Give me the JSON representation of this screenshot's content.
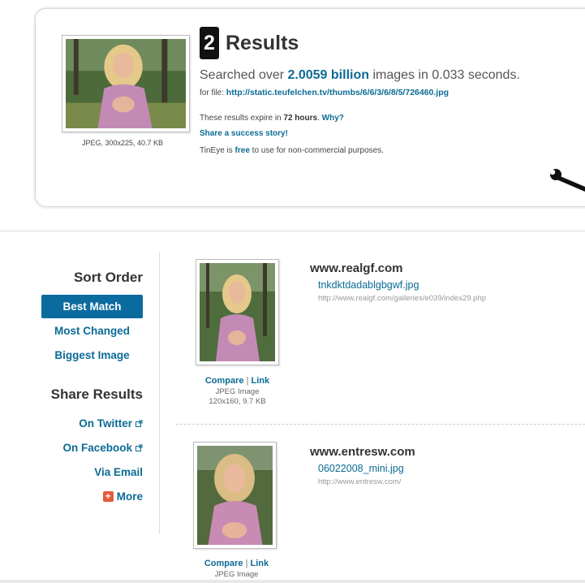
{
  "summary": {
    "result_count": "2",
    "results_word": "Results",
    "searched_prefix": "Searched over ",
    "searched_count": "2.0059 billion",
    "searched_suffix": " images in 0.033 seconds.",
    "for_file_label": "for file: ",
    "file_url": "http://static.teufelchen.tv/thumbs/6/6/3/6/8/5/726460.jpg",
    "query_meta": "JPEG, 300x225, 40.7 KB",
    "expire_prefix": "These results expire in ",
    "expire_hours": "72 hours",
    "expire_suffix": ". ",
    "why_link": "Why?",
    "success_link": "Share a success story!",
    "free_prefix": "TinEye is ",
    "free_word": "free",
    "free_suffix": " to use for non-commercial purposes."
  },
  "sidebar": {
    "sort_heading": "Sort Order",
    "sort_options": [
      "Best Match",
      "Most Changed",
      "Biggest Image"
    ],
    "share_heading": "Share Results",
    "share_links": [
      "On Twitter",
      "On Facebook",
      "Via Email",
      "More"
    ]
  },
  "matches": [
    {
      "domain": "www.realgf.com",
      "filename": "tnkdktdadablgbgwf.jpg",
      "url": "http://www.realgf.com/galleries/e039/index29.php",
      "compare": "Compare",
      "separator": "|",
      "link": "Link",
      "image_type": "JPEG Image",
      "image_size": "120x160, 9.7 KB"
    },
    {
      "domain": "www.entresw.com",
      "filename": "06022008_mini.jpg",
      "url": "http://www.entresw.com/",
      "compare": "Compare",
      "separator": "|",
      "link": "Link",
      "image_type": "JPEG Image"
    }
  ],
  "colors": {
    "link": "#0b6b95",
    "active_sort_bg": "#0b6b9f",
    "badge_bg": "#111111",
    "more_icon": "#e8593a"
  },
  "icons": [
    "wrench-icon",
    "external-link-icon",
    "plus-icon"
  ]
}
